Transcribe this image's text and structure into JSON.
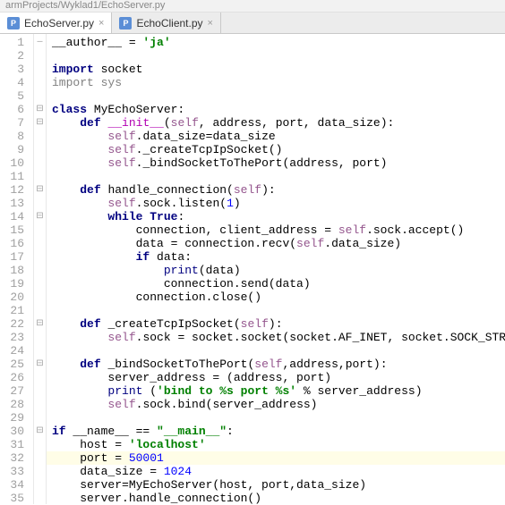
{
  "breadcrumb": "armProjects/Wyklad1/EchoServer.py",
  "tabs": [
    {
      "label": "EchoServer.py",
      "icon": "P",
      "active": true
    },
    {
      "label": "EchoClient.py",
      "icon": "P",
      "active": false
    }
  ],
  "highlight_line": 32,
  "fold_markers": {
    "1": "—",
    "6": "⊟",
    "7": "⊟",
    "12": "⊟",
    "14": "⊟",
    "22": "⊟",
    "25": "⊟",
    "30": "⊟"
  },
  "lines": [
    {
      "n": 1,
      "tok": [
        [
          "id",
          "__author__ = "
        ],
        [
          "str",
          "'ja'"
        ]
      ]
    },
    {
      "n": 2,
      "tok": []
    },
    {
      "n": 3,
      "tok": [
        [
          "kw",
          "import "
        ],
        [
          "id",
          "socket"
        ]
      ]
    },
    {
      "n": 4,
      "tok": [
        [
          "imp",
          "import "
        ],
        [
          "imp",
          "sys"
        ]
      ]
    },
    {
      "n": 5,
      "tok": []
    },
    {
      "n": 6,
      "tok": [
        [
          "kw",
          "class "
        ],
        [
          "id",
          "MyEchoServer:"
        ]
      ]
    },
    {
      "n": 7,
      "tok": [
        [
          "id",
          "    "
        ],
        [
          "kw",
          "def "
        ],
        [
          "dunder",
          "__init__"
        ],
        [
          "id",
          "("
        ],
        [
          "slf",
          "self"
        ],
        [
          "id",
          ", address, port, data_size):"
        ]
      ]
    },
    {
      "n": 8,
      "tok": [
        [
          "id",
          "        "
        ],
        [
          "slf",
          "self"
        ],
        [
          "id",
          ".data_size=data_size"
        ]
      ]
    },
    {
      "n": 9,
      "tok": [
        [
          "id",
          "        "
        ],
        [
          "slf",
          "self"
        ],
        [
          "id",
          "._createTcpIpSocket()"
        ]
      ]
    },
    {
      "n": 10,
      "tok": [
        [
          "id",
          "        "
        ],
        [
          "slf",
          "self"
        ],
        [
          "id",
          "._bindSocketToThePort(address, port)"
        ]
      ]
    },
    {
      "n": 11,
      "tok": []
    },
    {
      "n": 12,
      "tok": [
        [
          "id",
          "    "
        ],
        [
          "kw",
          "def "
        ],
        [
          "id",
          "handle_connection("
        ],
        [
          "slf",
          "self"
        ],
        [
          "id",
          "):"
        ]
      ]
    },
    {
      "n": 13,
      "tok": [
        [
          "id",
          "        "
        ],
        [
          "slf",
          "self"
        ],
        [
          "id",
          ".sock.listen("
        ],
        [
          "num",
          "1"
        ],
        [
          "id",
          ")"
        ]
      ]
    },
    {
      "n": 14,
      "tok": [
        [
          "id",
          "        "
        ],
        [
          "kw",
          "while True"
        ],
        [
          "id",
          ":"
        ]
      ]
    },
    {
      "n": 15,
      "tok": [
        [
          "id",
          "            connection, client_address = "
        ],
        [
          "slf",
          "self"
        ],
        [
          "id",
          ".sock.accept()"
        ]
      ]
    },
    {
      "n": 16,
      "tok": [
        [
          "id",
          "            data = connection.recv("
        ],
        [
          "slf",
          "self"
        ],
        [
          "id",
          ".data_size)"
        ]
      ]
    },
    {
      "n": 17,
      "tok": [
        [
          "id",
          "            "
        ],
        [
          "kw",
          "if "
        ],
        [
          "id",
          "data:"
        ]
      ]
    },
    {
      "n": 18,
      "tok": [
        [
          "id",
          "                "
        ],
        [
          "bi",
          "print"
        ],
        [
          "id",
          "(data)"
        ]
      ]
    },
    {
      "n": 19,
      "tok": [
        [
          "id",
          "                connection.send(data)"
        ]
      ]
    },
    {
      "n": 20,
      "tok": [
        [
          "id",
          "            connection.close()"
        ]
      ]
    },
    {
      "n": 21,
      "tok": []
    },
    {
      "n": 22,
      "tok": [
        [
          "id",
          "    "
        ],
        [
          "kw",
          "def "
        ],
        [
          "id",
          "_createTcpIpSocket("
        ],
        [
          "slf",
          "self"
        ],
        [
          "id",
          "):"
        ]
      ]
    },
    {
      "n": 23,
      "tok": [
        [
          "id",
          "        "
        ],
        [
          "slf",
          "self"
        ],
        [
          "id",
          ".sock = socket.socket(socket.AF_INET, socket.SOCK_STREAM)"
        ]
      ]
    },
    {
      "n": 24,
      "tok": []
    },
    {
      "n": 25,
      "tok": [
        [
          "id",
          "    "
        ],
        [
          "kw",
          "def "
        ],
        [
          "id",
          "_bindSocketToThePort("
        ],
        [
          "slf",
          "self"
        ],
        [
          "id",
          ",address,port):"
        ]
      ]
    },
    {
      "n": 26,
      "tok": [
        [
          "id",
          "        server_address = (address, port)"
        ]
      ]
    },
    {
      "n": 27,
      "tok": [
        [
          "id",
          "        "
        ],
        [
          "bi",
          "print "
        ],
        [
          "id",
          "("
        ],
        [
          "str",
          "'bind to %s port %s'"
        ],
        [
          "id",
          " % server_address)"
        ]
      ]
    },
    {
      "n": 28,
      "tok": [
        [
          "id",
          "        "
        ],
        [
          "slf",
          "self"
        ],
        [
          "id",
          ".sock.bind(server_address)"
        ]
      ]
    },
    {
      "n": 29,
      "tok": []
    },
    {
      "n": 30,
      "tok": [
        [
          "kw",
          "if "
        ],
        [
          "id",
          "__name__ == "
        ],
        [
          "str",
          "\"__main__\""
        ],
        [
          "id",
          ":"
        ]
      ]
    },
    {
      "n": 31,
      "tok": [
        [
          "id",
          "    host = "
        ],
        [
          "str",
          "'localhost'"
        ]
      ]
    },
    {
      "n": 32,
      "tok": [
        [
          "id",
          "    port = "
        ],
        [
          "num",
          "50001"
        ]
      ]
    },
    {
      "n": 33,
      "tok": [
        [
          "id",
          "    data_size = "
        ],
        [
          "num",
          "1024"
        ]
      ]
    },
    {
      "n": 34,
      "tok": [
        [
          "id",
          "    server=MyEchoServer(host, port,data_size)"
        ]
      ]
    },
    {
      "n": 35,
      "tok": [
        [
          "id",
          "    server.handle_connection()"
        ]
      ]
    }
  ]
}
